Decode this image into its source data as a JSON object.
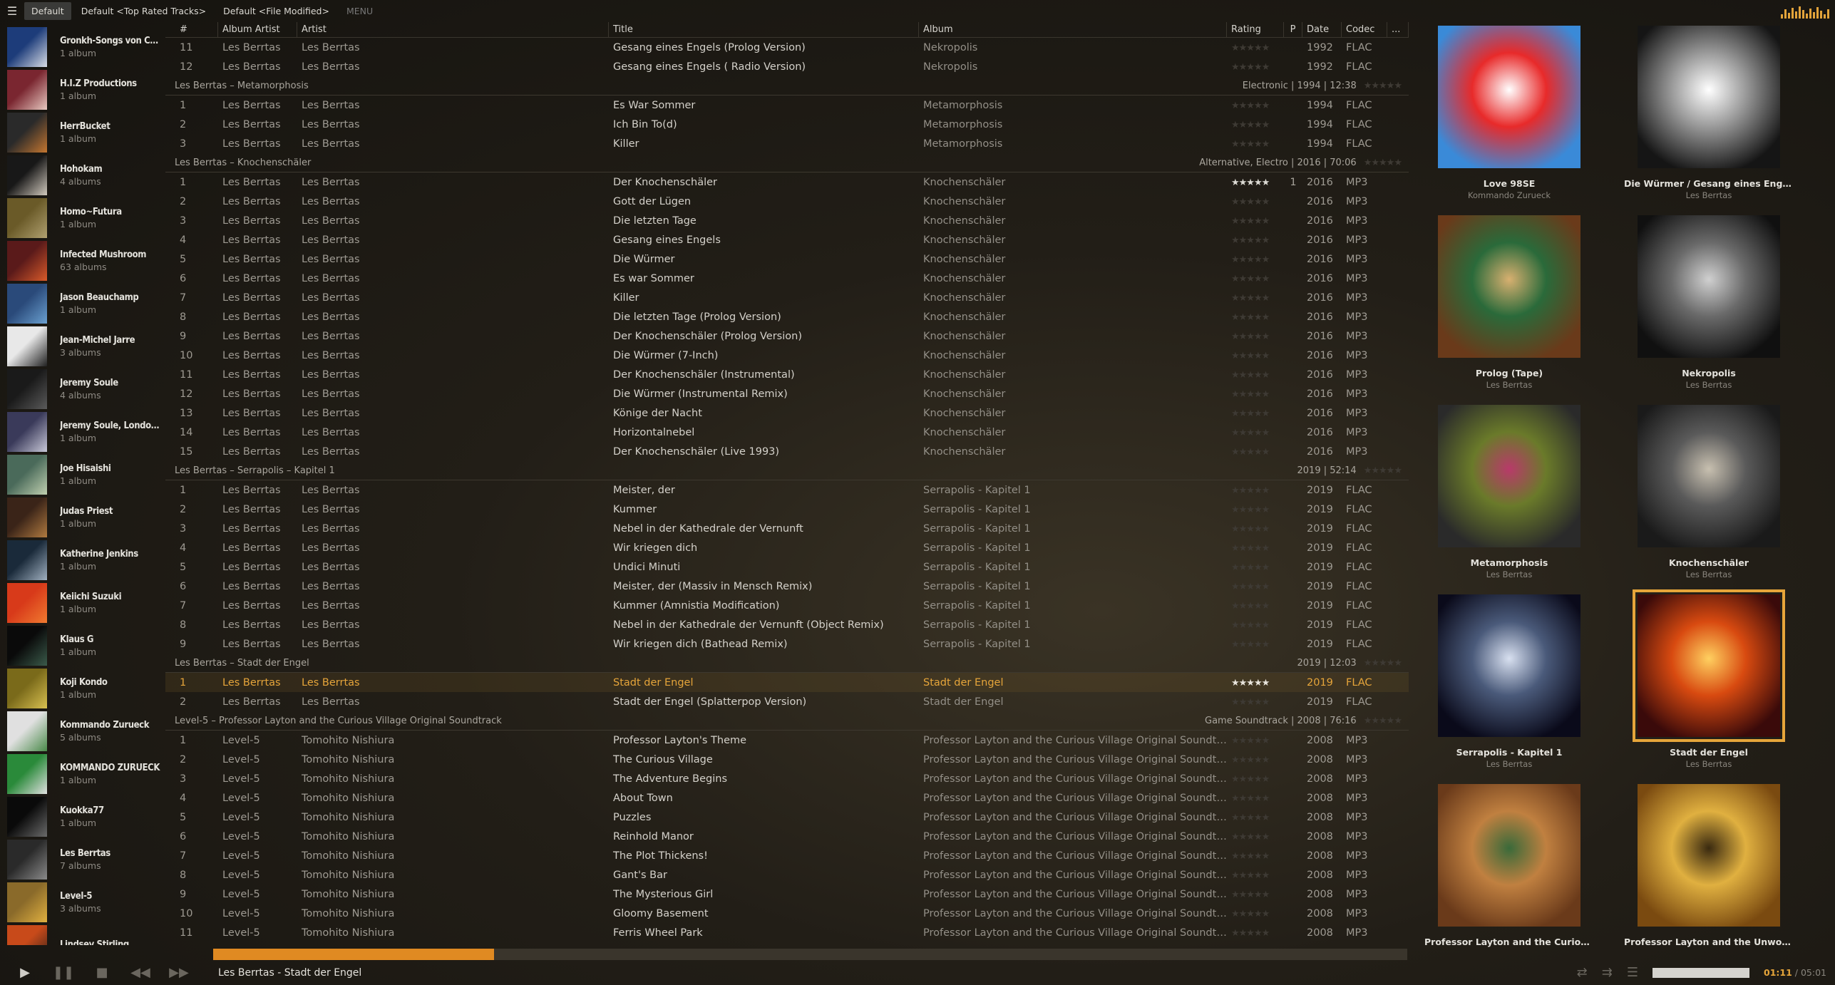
{
  "toolbar": {
    "tabs": [
      "Default",
      "Default <Top Rated Tracks>",
      "Default <File Modified>"
    ],
    "menu": "MENU"
  },
  "sidebar": [
    {
      "name": "Gronkh-Songs von Coli...",
      "count": "1 album",
      "c1": "#1d3c7a",
      "c2": "#d8dce6"
    },
    {
      "name": "H.I.Z Productions",
      "count": "1 album",
      "c1": "#7a2630",
      "c2": "#e8c8c0"
    },
    {
      "name": "HerrBucket",
      "count": "1 album",
      "c1": "#2a2a2a",
      "c2": "#c47630"
    },
    {
      "name": "Hohokam",
      "count": "4 albums",
      "c1": "#181818",
      "c2": "#d0c8bc"
    },
    {
      "name": "Homo~Futura",
      "count": "1 album",
      "c1": "#6a5a28",
      "c2": "#b0a070"
    },
    {
      "name": "Infected Mushroom",
      "count": "63 albums",
      "c1": "#5a1a1a",
      "c2": "#d85a2a"
    },
    {
      "name": "Jason Beauchamp",
      "count": "1 album",
      "c1": "#2a4a7a",
      "c2": "#6aa0d0"
    },
    {
      "name": "Jean-Michel Jarre",
      "count": "3 albums",
      "c1": "#e8e8e8",
      "c2": "#202020"
    },
    {
      "name": "Jeremy Soule",
      "count": "4 albums",
      "c1": "#1a1a1a",
      "c2": "#5a5a5a"
    },
    {
      "name": "Jeremy Soule, London S...",
      "count": "1 album",
      "c1": "#3a3a5a",
      "c2": "#c8c8d8"
    },
    {
      "name": "Joe Hisaishi",
      "count": "1 album",
      "c1": "#4a6a5a",
      "c2": "#c0d0b0"
    },
    {
      "name": "Judas Priest",
      "count": "1 album",
      "c1": "#3a2418",
      "c2": "#b07a40"
    },
    {
      "name": "Katherine Jenkins",
      "count": "1 album",
      "c1": "#1a2a3a",
      "c2": "#a0b0c0"
    },
    {
      "name": "Keiichi Suzuki",
      "count": "1 album",
      "c1": "#d83a1a",
      "c2": "#f07a30"
    },
    {
      "name": "Klaus G",
      "count": "1 album",
      "c1": "#0a0a0a",
      "c2": "#3a5a4a"
    },
    {
      "name": "Koji Kondo",
      "count": "1 album",
      "c1": "#7a6a1a",
      "c2": "#d8c050"
    },
    {
      "name": "Kommando Zurueck",
      "count": "5 albums",
      "c1": "#e0e0e0",
      "c2": "#4a8a4a"
    },
    {
      "name": "KOMMANDO ZURUECK",
      "count": "1 album",
      "c1": "#2a8a3a",
      "c2": "#e0e0e0"
    },
    {
      "name": "Kuokka77",
      "count": "1 album",
      "c1": "#0a0a0a",
      "c2": "#6a6a6a"
    },
    {
      "name": "Les Berrtas",
      "count": "7 albums",
      "c1": "#2a2a2a",
      "c2": "#8a8a8a"
    },
    {
      "name": "Level-5",
      "count": "3 albums",
      "c1": "#8a6a2a",
      "c2": "#e0b040"
    },
    {
      "name": "Lindsey Stirling",
      "count": "",
      "c1": "#c84a1a",
      "c2": "#302018"
    }
  ],
  "columns": {
    "num": "#",
    "album_artist": "Album Artist",
    "artist": "Artist",
    "title": "Title",
    "album": "Album",
    "rating": "Rating",
    "p": "P",
    "date": "Date",
    "codec": "Codec",
    "more": "..."
  },
  "groups": [
    {
      "header": "",
      "info": "",
      "rows": [
        {
          "n": "11",
          "aa": "Les Berrtas",
          "ar": "Les Berrtas",
          "t": "Gesang eines Engels (Prolog Version)",
          "al": "Nekropolis",
          "r": 0,
          "p": "",
          "d": "1992",
          "c": "FLAC"
        },
        {
          "n": "12",
          "aa": "Les Berrtas",
          "ar": "Les Berrtas",
          "t": "Gesang eines Engels ( Radio Version)",
          "al": "Nekropolis",
          "r": 0,
          "p": "",
          "d": "1992",
          "c": "FLAC"
        }
      ]
    },
    {
      "header": "Les Berrtas – Metamorphosis",
      "info": "Electronic | 1994 | 12:38",
      "rows": [
        {
          "n": "1",
          "aa": "Les Berrtas",
          "ar": "Les Berrtas",
          "t": "Es War Sommer",
          "al": "Metamorphosis",
          "r": 0,
          "p": "",
          "d": "1994",
          "c": "FLAC"
        },
        {
          "n": "2",
          "aa": "Les Berrtas",
          "ar": "Les Berrtas",
          "t": "Ich Bin To(d)",
          "al": "Metamorphosis",
          "r": 0,
          "p": "",
          "d": "1994",
          "c": "FLAC"
        },
        {
          "n": "3",
          "aa": "Les Berrtas",
          "ar": "Les Berrtas",
          "t": "Killer",
          "al": "Metamorphosis",
          "r": 0,
          "p": "",
          "d": "1994",
          "c": "FLAC"
        }
      ]
    },
    {
      "header": "Les Berrtas – Knochenschäler",
      "info": "Alternative, Electro | 2016 | 70:06",
      "rows": [
        {
          "n": "1",
          "aa": "Les Berrtas",
          "ar": "Les Berrtas",
          "t": "Der Knochenschäler",
          "al": "Knochenschäler",
          "r": 5,
          "p": "1",
          "d": "2016",
          "c": "MP3"
        },
        {
          "n": "2",
          "aa": "Les Berrtas",
          "ar": "Les Berrtas",
          "t": "Gott der Lügen",
          "al": "Knochenschäler",
          "r": 0,
          "p": "",
          "d": "2016",
          "c": "MP3"
        },
        {
          "n": "3",
          "aa": "Les Berrtas",
          "ar": "Les Berrtas",
          "t": "Die letzten Tage",
          "al": "Knochenschäler",
          "r": 0,
          "p": "",
          "d": "2016",
          "c": "MP3"
        },
        {
          "n": "4",
          "aa": "Les Berrtas",
          "ar": "Les Berrtas",
          "t": "Gesang eines Engels",
          "al": "Knochenschäler",
          "r": 0,
          "p": "",
          "d": "2016",
          "c": "MP3"
        },
        {
          "n": "5",
          "aa": "Les Berrtas",
          "ar": "Les Berrtas",
          "t": "Die Würmer",
          "al": "Knochenschäler",
          "r": 0,
          "p": "",
          "d": "2016",
          "c": "MP3"
        },
        {
          "n": "6",
          "aa": "Les Berrtas",
          "ar": "Les Berrtas",
          "t": "Es war Sommer",
          "al": "Knochenschäler",
          "r": 0,
          "p": "",
          "d": "2016",
          "c": "MP3"
        },
        {
          "n": "7",
          "aa": "Les Berrtas",
          "ar": "Les Berrtas",
          "t": "Killer",
          "al": "Knochenschäler",
          "r": 0,
          "p": "",
          "d": "2016",
          "c": "MP3"
        },
        {
          "n": "8",
          "aa": "Les Berrtas",
          "ar": "Les Berrtas",
          "t": "Die letzten Tage (Prolog Version)",
          "al": "Knochenschäler",
          "r": 0,
          "p": "",
          "d": "2016",
          "c": "MP3"
        },
        {
          "n": "9",
          "aa": "Les Berrtas",
          "ar": "Les Berrtas",
          "t": "Der Knochenschäler (Prolog Version)",
          "al": "Knochenschäler",
          "r": 0,
          "p": "",
          "d": "2016",
          "c": "MP3"
        },
        {
          "n": "10",
          "aa": "Les Berrtas",
          "ar": "Les Berrtas",
          "t": "Die Würmer (7-Inch)",
          "al": "Knochenschäler",
          "r": 0,
          "p": "",
          "d": "2016",
          "c": "MP3"
        },
        {
          "n": "11",
          "aa": "Les Berrtas",
          "ar": "Les Berrtas",
          "t": "Der Knochenschäler (Instrumental)",
          "al": "Knochenschäler",
          "r": 0,
          "p": "",
          "d": "2016",
          "c": "MP3"
        },
        {
          "n": "12",
          "aa": "Les Berrtas",
          "ar": "Les Berrtas",
          "t": "Die Würmer (Instrumental Remix)",
          "al": "Knochenschäler",
          "r": 0,
          "p": "",
          "d": "2016",
          "c": "MP3"
        },
        {
          "n": "13",
          "aa": "Les Berrtas",
          "ar": "Les Berrtas",
          "t": "Könige der Nacht",
          "al": "Knochenschäler",
          "r": 0,
          "p": "",
          "d": "2016",
          "c": "MP3"
        },
        {
          "n": "14",
          "aa": "Les Berrtas",
          "ar": "Les Berrtas",
          "t": "Horizontalnebel",
          "al": "Knochenschäler",
          "r": 0,
          "p": "",
          "d": "2016",
          "c": "MP3"
        },
        {
          "n": "15",
          "aa": "Les Berrtas",
          "ar": "Les Berrtas",
          "t": "Der Knochenschäler (Live 1993)",
          "al": "Knochenschäler",
          "r": 0,
          "p": "",
          "d": "2016",
          "c": "MP3"
        }
      ]
    },
    {
      "header": "Les Berrtas – Serrapolis – Kapitel 1",
      "info": "2019 | 52:14",
      "rows": [
        {
          "n": "1",
          "aa": "Les Berrtas",
          "ar": "Les Berrtas",
          "t": "Meister, der",
          "al": "Serrapolis - Kapitel 1",
          "r": 0,
          "p": "",
          "d": "2019",
          "c": "FLAC"
        },
        {
          "n": "2",
          "aa": "Les Berrtas",
          "ar": "Les Berrtas",
          "t": "Kummer",
          "al": "Serrapolis - Kapitel 1",
          "r": 0,
          "p": "",
          "d": "2019",
          "c": "FLAC"
        },
        {
          "n": "3",
          "aa": "Les Berrtas",
          "ar": "Les Berrtas",
          "t": "Nebel in der Kathedrale der Vernunft",
          "al": "Serrapolis - Kapitel 1",
          "r": 0,
          "p": "",
          "d": "2019",
          "c": "FLAC"
        },
        {
          "n": "4",
          "aa": "Les Berrtas",
          "ar": "Les Berrtas",
          "t": "Wir kriegen dich",
          "al": "Serrapolis - Kapitel 1",
          "r": 0,
          "p": "",
          "d": "2019",
          "c": "FLAC"
        },
        {
          "n": "5",
          "aa": "Les Berrtas",
          "ar": "Les Berrtas",
          "t": "Undici Minuti",
          "al": "Serrapolis - Kapitel 1",
          "r": 0,
          "p": "",
          "d": "2019",
          "c": "FLAC"
        },
        {
          "n": "6",
          "aa": "Les Berrtas",
          "ar": "Les Berrtas",
          "t": "Meister, der (Massiv in Mensch Remix)",
          "al": "Serrapolis - Kapitel 1",
          "r": 0,
          "p": "",
          "d": "2019",
          "c": "FLAC"
        },
        {
          "n": "7",
          "aa": "Les Berrtas",
          "ar": "Les Berrtas",
          "t": "Kummer (Amnistia Modification)",
          "al": "Serrapolis - Kapitel 1",
          "r": 0,
          "p": "",
          "d": "2019",
          "c": "FLAC"
        },
        {
          "n": "8",
          "aa": "Les Berrtas",
          "ar": "Les Berrtas",
          "t": "Nebel in der Kathedrale der Vernunft (Object Remix)",
          "al": "Serrapolis - Kapitel 1",
          "r": 0,
          "p": "",
          "d": "2019",
          "c": "FLAC"
        },
        {
          "n": "9",
          "aa": "Les Berrtas",
          "ar": "Les Berrtas",
          "t": "Wir kriegen dich (Bathead Remix)",
          "al": "Serrapolis - Kapitel 1",
          "r": 0,
          "p": "",
          "d": "2019",
          "c": "FLAC"
        }
      ]
    },
    {
      "header": "Les Berrtas – Stadt der Engel",
      "info": "2019 | 12:03",
      "rows": [
        {
          "n": "1",
          "aa": "Les Berrtas",
          "ar": "Les Berrtas",
          "t": "Stadt der Engel",
          "al": "Stadt der Engel",
          "r": 5,
          "p": "",
          "d": "2019",
          "c": "FLAC",
          "playing": true
        },
        {
          "n": "2",
          "aa": "Les Berrtas",
          "ar": "Les Berrtas",
          "t": "Stadt der Engel (Splatterpop Version)",
          "al": "Stadt der Engel",
          "r": 0,
          "p": "",
          "d": "2019",
          "c": "FLAC"
        }
      ]
    },
    {
      "header": "Level-5 – Professor Layton and the Curious Village Original Soundtrack",
      "info": "Game Soundtrack | 2008 | 76:16",
      "rows": [
        {
          "n": "1",
          "aa": "Level-5",
          "ar": "Tomohito Nishiura",
          "t": "Professor Layton's Theme",
          "al": "Professor Layton and the Curious Village Original Soundtrack",
          "r": 0,
          "p": "",
          "d": "2008",
          "c": "MP3"
        },
        {
          "n": "2",
          "aa": "Level-5",
          "ar": "Tomohito Nishiura",
          "t": "The Curious Village",
          "al": "Professor Layton and the Curious Village Original Soundtrack",
          "r": 0,
          "p": "",
          "d": "2008",
          "c": "MP3"
        },
        {
          "n": "3",
          "aa": "Level-5",
          "ar": "Tomohito Nishiura",
          "t": "The Adventure Begins",
          "al": "Professor Layton and the Curious Village Original Soundtrack",
          "r": 0,
          "p": "",
          "d": "2008",
          "c": "MP3"
        },
        {
          "n": "4",
          "aa": "Level-5",
          "ar": "Tomohito Nishiura",
          "t": "About Town",
          "al": "Professor Layton and the Curious Village Original Soundtrack",
          "r": 0,
          "p": "",
          "d": "2008",
          "c": "MP3"
        },
        {
          "n": "5",
          "aa": "Level-5",
          "ar": "Tomohito Nishiura",
          "t": "Puzzles",
          "al": "Professor Layton and the Curious Village Original Soundtrack",
          "r": 0,
          "p": "",
          "d": "2008",
          "c": "MP3"
        },
        {
          "n": "6",
          "aa": "Level-5",
          "ar": "Tomohito Nishiura",
          "t": "Reinhold Manor",
          "al": "Professor Layton and the Curious Village Original Soundtrack",
          "r": 0,
          "p": "",
          "d": "2008",
          "c": "MP3"
        },
        {
          "n": "7",
          "aa": "Level-5",
          "ar": "Tomohito Nishiura",
          "t": "The Plot Thickens!",
          "al": "Professor Layton and the Curious Village Original Soundtrack",
          "r": 0,
          "p": "",
          "d": "2008",
          "c": "MP3"
        },
        {
          "n": "8",
          "aa": "Level-5",
          "ar": "Tomohito Nishiura",
          "t": "Gant's Bar",
          "al": "Professor Layton and the Curious Village Original Soundtrack",
          "r": 0,
          "p": "",
          "d": "2008",
          "c": "MP3"
        },
        {
          "n": "9",
          "aa": "Level-5",
          "ar": "Tomohito Nishiura",
          "t": "The Mysterious Girl",
          "al": "Professor Layton and the Curious Village Original Soundtrack",
          "r": 0,
          "p": "",
          "d": "2008",
          "c": "MP3"
        },
        {
          "n": "10",
          "aa": "Level-5",
          "ar": "Tomohito Nishiura",
          "t": "Gloomy Basement",
          "al": "Professor Layton and the Curious Village Original Soundtrack",
          "r": 0,
          "p": "",
          "d": "2008",
          "c": "MP3"
        },
        {
          "n": "11",
          "aa": "Level-5",
          "ar": "Tomohito Nishiura",
          "t": "Ferris Wheel Park",
          "al": "Professor Layton and the Curious Village Original Soundtrack",
          "r": 0,
          "p": "",
          "d": "2008",
          "c": "MP3"
        }
      ]
    }
  ],
  "albums": [
    {
      "title": "Love 98SE",
      "artist": "Kommando Zurueck",
      "c1": "#3a8ad8",
      "c2": "#e82a2a",
      "c3": "#ffffff",
      "selected": false
    },
    {
      "title": "Die Würmer / Gesang eines Enge...",
      "artist": "Les Berrtas",
      "c1": "#151515",
      "c2": "#9a9a9a",
      "c3": "#ffffff",
      "selected": false
    },
    {
      "title": "Prolog (Tape)",
      "artist": "Les Berrtas",
      "c1": "#6a3a1a",
      "c2": "#2a6a3a",
      "c3": "#d8b070",
      "selected": false
    },
    {
      "title": "Nekropolis",
      "artist": "Les Berrtas",
      "c1": "#101010",
      "c2": "#6a6a6a",
      "c3": "#d0d0d0",
      "selected": false
    },
    {
      "title": "Metamorphosis",
      "artist": "Les Berrtas",
      "c1": "#2a2a2a",
      "c2": "#6a7a2a",
      "c3": "#b83a6a",
      "selected": false
    },
    {
      "title": "Knochenschäler",
      "artist": "Les Berrtas",
      "c1": "#1a1a1a",
      "c2": "#5a5a5a",
      "c3": "#c8c0b0",
      "selected": false
    },
    {
      "title": "Serrapolis - Kapitel 1",
      "artist": "Les Berrtas",
      "c1": "#0a0a1a",
      "c2": "#4a5a7a",
      "c3": "#d8e0f0",
      "selected": false
    },
    {
      "title": "Stadt der Engel",
      "artist": "Les Berrtas",
      "c1": "#3a0a0a",
      "c2": "#d84a10",
      "c3": "#ffd060",
      "selected": true
    },
    {
      "title": "Professor Layton and the Curiou...",
      "artist": "",
      "c1": "#6a3a1a",
      "c2": "#c08040",
      "c3": "#3a6a3a",
      "selected": false
    },
    {
      "title": "Professor Layton and the Unwou...",
      "artist": "",
      "c1": "#7a4a10",
      "c2": "#e0b040",
      "c3": "#3a2a10",
      "selected": false
    }
  ],
  "playback": {
    "now_playing": "Les Berrtas - Stadt der Engel",
    "elapsed": "01:11",
    "total": "05:01",
    "progress": 0.2355,
    "volume": 1.0
  },
  "colors": {
    "accent": "#e6a53a",
    "progress": "#e08a22"
  },
  "icons": {
    "menu": "hamburger-icon",
    "play": "play-icon",
    "pause": "pause-icon",
    "stop": "stop-icon",
    "prev": "previous-icon",
    "next": "next-icon",
    "shuffle": "shuffle-icon",
    "repeat": "repeat-icon",
    "playlist": "playlist-icon"
  }
}
